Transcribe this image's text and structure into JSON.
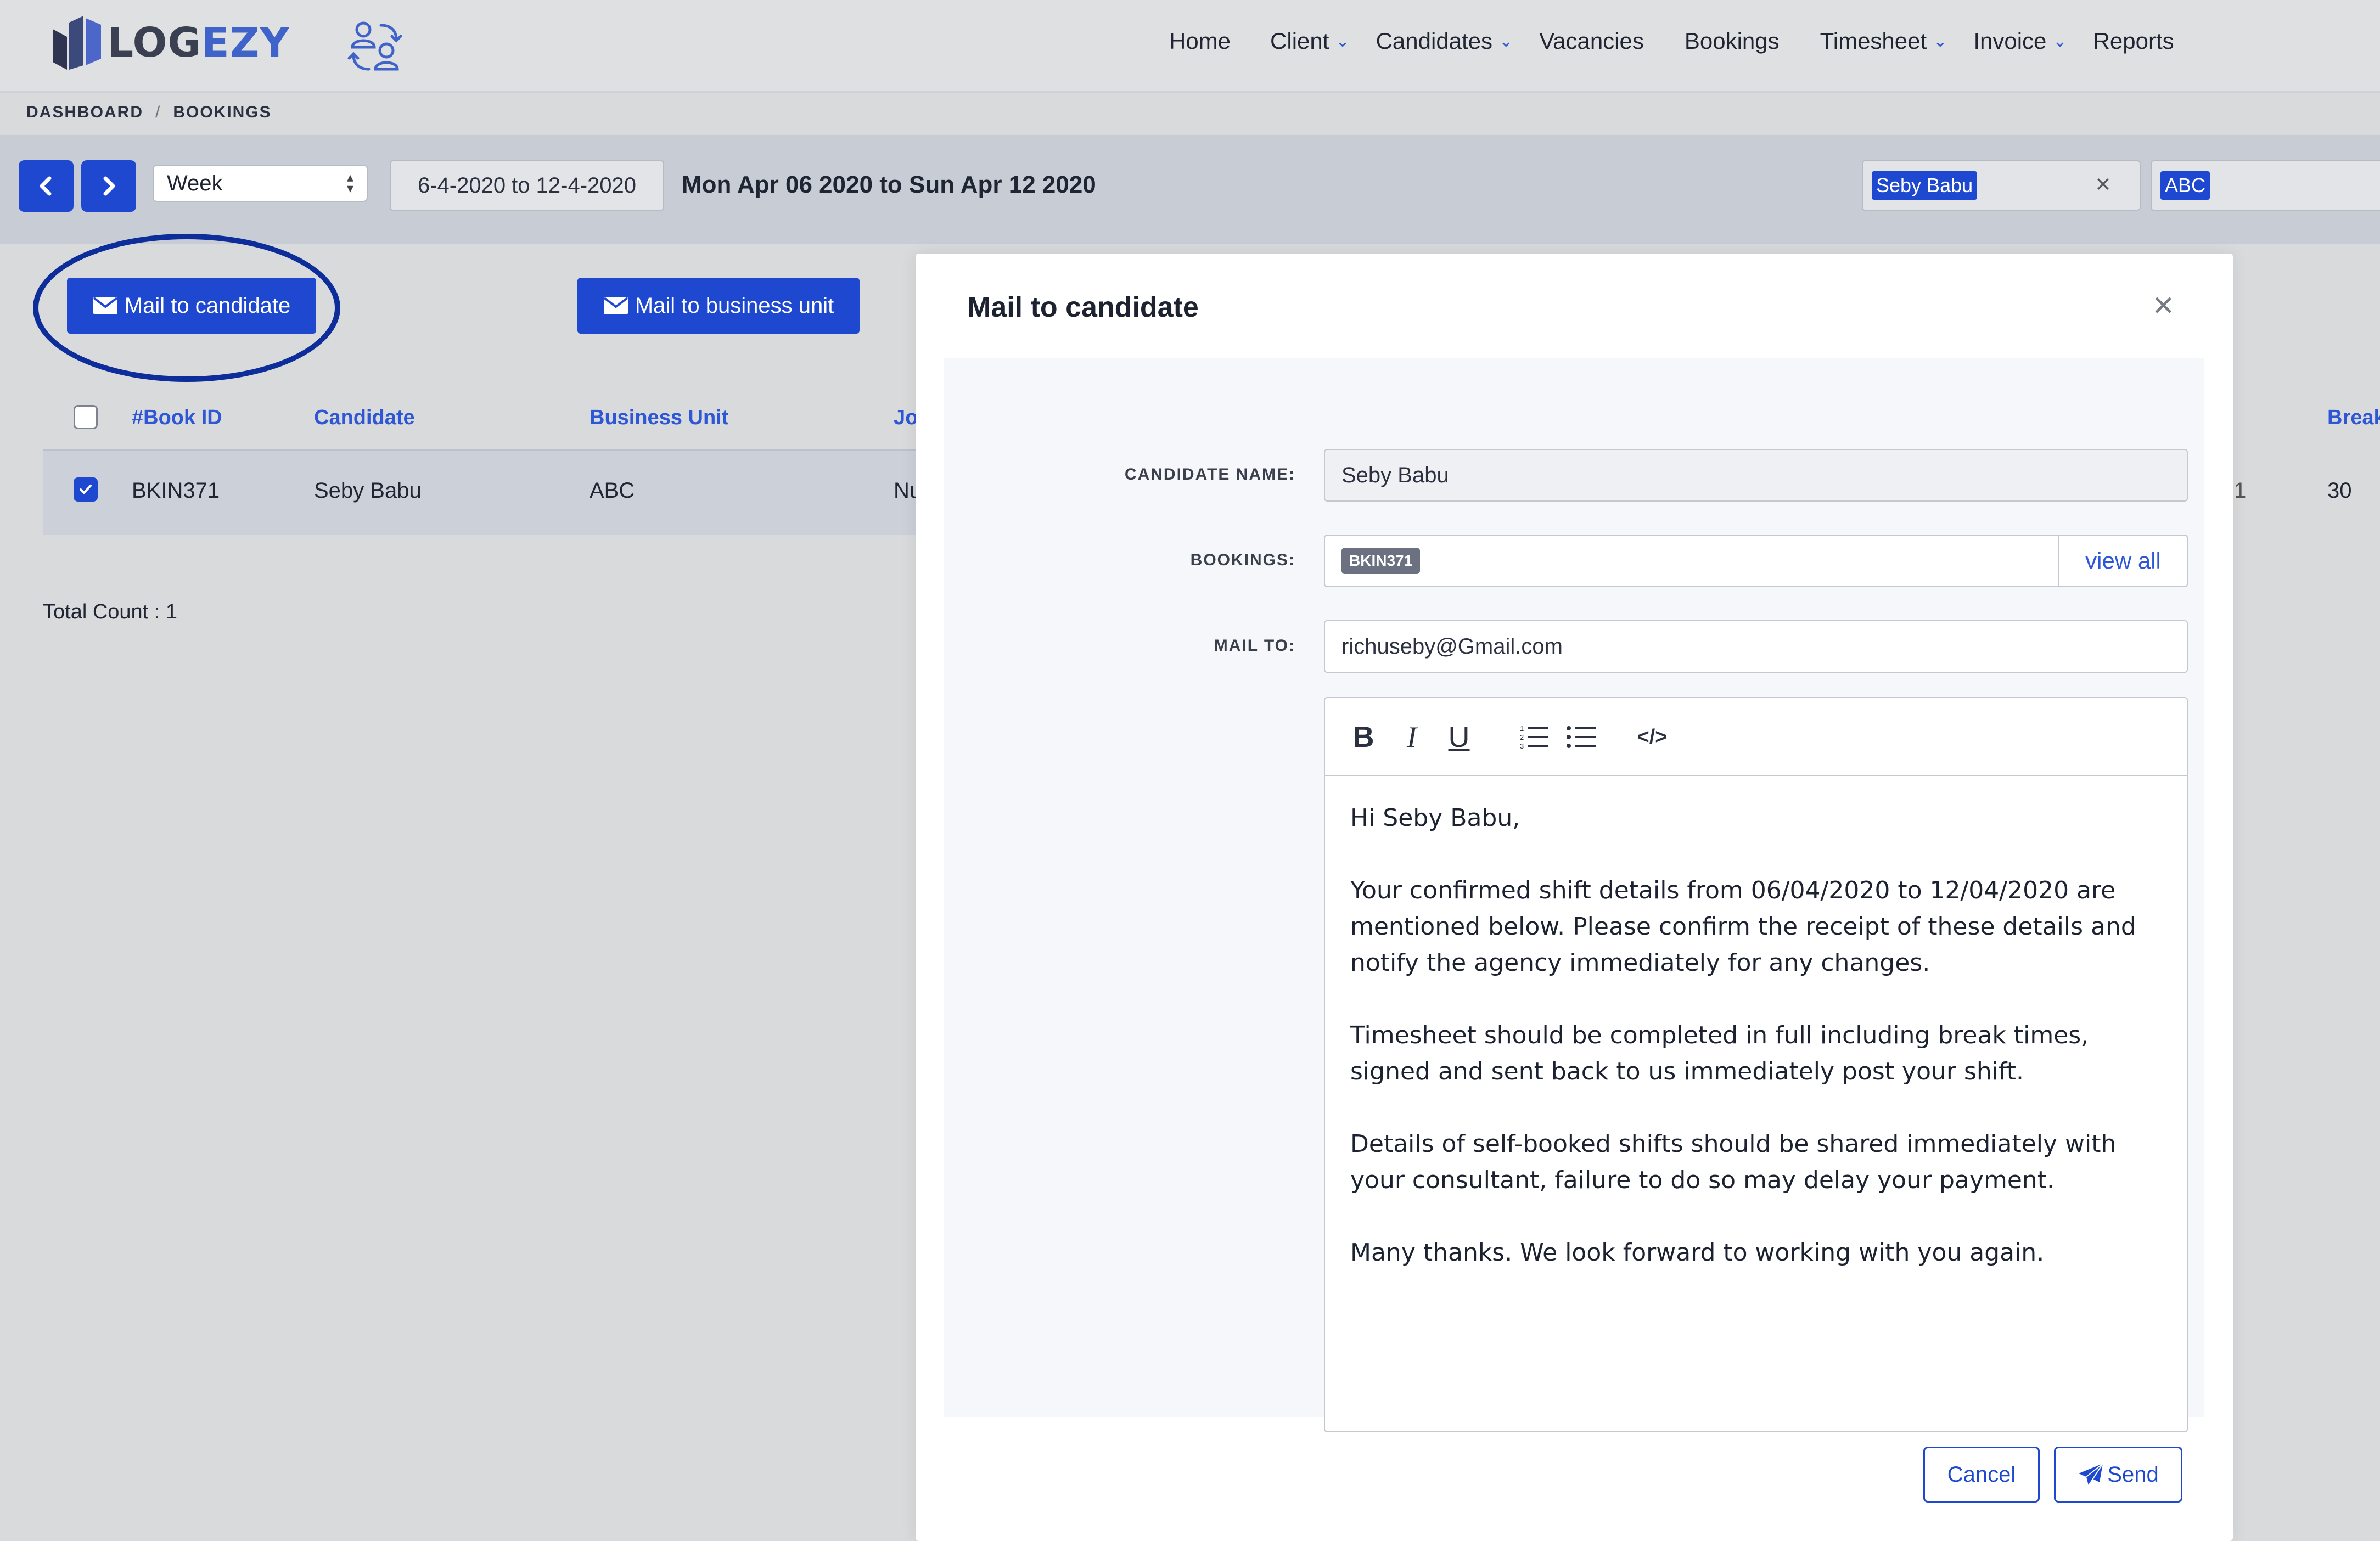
{
  "app": {
    "logo_text_main": "LOG",
    "logo_text_accent": "EZY"
  },
  "nav": {
    "items": [
      {
        "label": "Home",
        "has_dropdown": false
      },
      {
        "label": "Client",
        "has_dropdown": true
      },
      {
        "label": "Candidates",
        "has_dropdown": true
      },
      {
        "label": "Vacancies",
        "has_dropdown": false
      },
      {
        "label": "Bookings",
        "has_dropdown": false
      },
      {
        "label": "Timesheet",
        "has_dropdown": true
      },
      {
        "label": "Invoice",
        "has_dropdown": true
      },
      {
        "label": "Reports",
        "has_dropdown": false
      }
    ]
  },
  "breadcrumb": {
    "root": "DASHBOARD",
    "separator": "/",
    "current": "BOOKINGS"
  },
  "filter": {
    "period_select": "Week",
    "date_range": "6-4-2020 to 12-4-2020",
    "period_text": "Mon Apr 06 2020 to Sun Apr 12 2020",
    "candidate_chip": "Seby Babu",
    "business_unit_chip": "ABC"
  },
  "actions": {
    "mail_candidate": "Mail to candidate",
    "mail_business_unit": "Mail to business unit"
  },
  "table": {
    "headers": {
      "book_id": "#Book ID",
      "candidate": "Candidate",
      "business_unit": "Business Unit",
      "job_partial": "Jo",
      "break_partial": "Break"
    },
    "rows": [
      {
        "checked": true,
        "book_id": "BKIN371",
        "candidate": "Seby Babu",
        "business_unit": "ABC",
        "job_partial": "Nu",
        "col_partial": "1",
        "break": "30"
      }
    ],
    "total_count": "Total Count : 1"
  },
  "modal": {
    "title": "Mail to candidate",
    "close_glyph": "×",
    "candidate_name_label": "CANDIDATE NAME:",
    "candidate_name_value": "Seby Babu",
    "bookings_label": "BOOKINGS:",
    "booking_tag": "BKIN371",
    "view_all": "view all",
    "mail_to_label": "MAIL TO:",
    "mail_to_value": "richuseby@Gmail.com",
    "toolbar": {
      "bold": "B",
      "italic": "I",
      "underline": "U",
      "code": "</>"
    },
    "body": {
      "greeting": "Hi Seby Babu,",
      "para1": "Your confirmed shift details from 06/04/2020 to 12/04/2020 are mentioned below. Please confirm the receipt of these details and notify the agency immediately for any changes.",
      "para2": "Timesheet should be completed in full including break times, signed and sent back to us immediately post your shift.",
      "para3": "Details of self-booked shifts should be shared immediately with your consultant, failure to do so may delay your payment.",
      "closing": "Many thanks. We look forward to working with you again."
    },
    "cancel": "Cancel",
    "send": "Send"
  },
  "colors": {
    "primary": "#1e48d0",
    "link": "#2e57d6",
    "ring": "#0d2d9a"
  }
}
